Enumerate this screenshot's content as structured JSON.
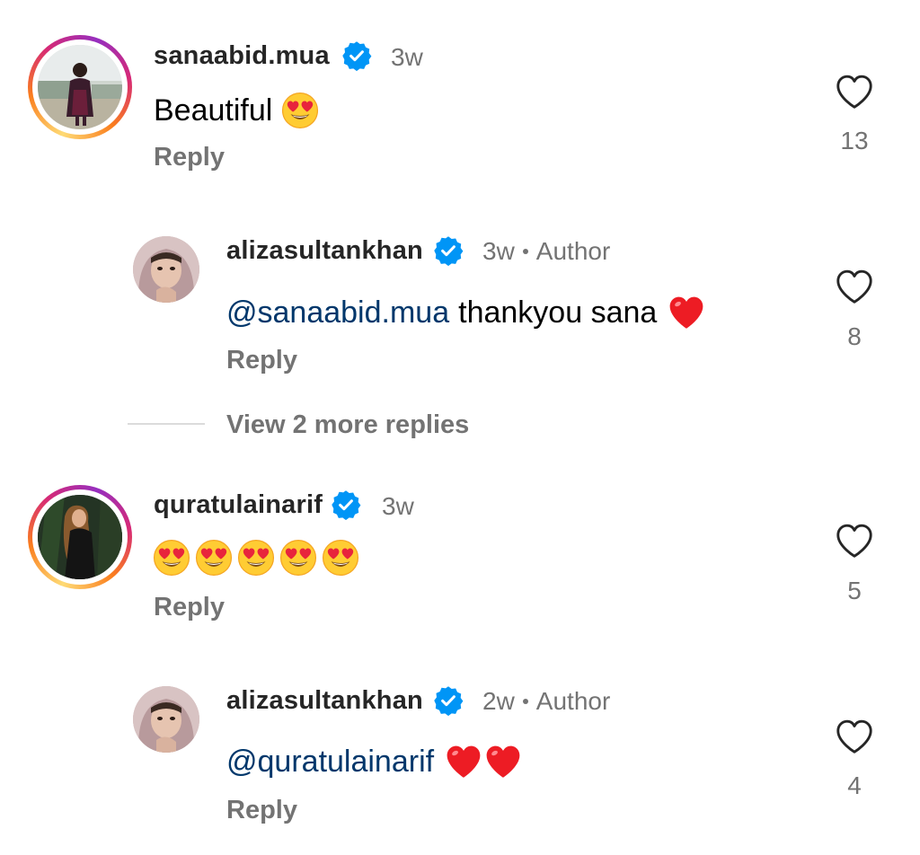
{
  "comments": [
    {
      "username": "sanaabid.mua",
      "verified": true,
      "time": "3w",
      "text": "Beautiful",
      "emojis": [
        "heart-eyes"
      ],
      "reply_label": "Reply",
      "likes": "13",
      "avatar_ring": true
    },
    {
      "username": "alizasultankhan",
      "verified": true,
      "time": "3w",
      "author_label": "Author",
      "mention": "@sanaabid.mua",
      "text": "thankyou sana",
      "emojis": [
        "red-heart"
      ],
      "reply_label": "Reply",
      "likes": "8",
      "is_reply": true
    },
    {
      "username": "quratulainarif",
      "verified": true,
      "time": "3w",
      "text": "",
      "emojis": [
        "heart-eyes",
        "heart-eyes",
        "heart-eyes",
        "heart-eyes",
        "heart-eyes"
      ],
      "reply_label": "Reply",
      "likes": "5",
      "avatar_ring": true
    },
    {
      "username": "alizasultankhan",
      "verified": true,
      "time": "2w",
      "author_label": "Author",
      "mention": "@quratulainarif",
      "text": "",
      "emojis": [
        "red-heart",
        "red-heart"
      ],
      "reply_label": "Reply",
      "likes": "4",
      "is_reply": true
    }
  ],
  "view_more_replies": "View 2 more replies",
  "colors": {
    "verified_badge": "#0095f6",
    "mention": "#00376b",
    "secondary_text": "#737373",
    "heart_red": "#ed1c24"
  },
  "icons": [
    "heart-outline-icon",
    "verified-badge-icon",
    "heart-eyes-emoji",
    "red-heart-emoji"
  ]
}
